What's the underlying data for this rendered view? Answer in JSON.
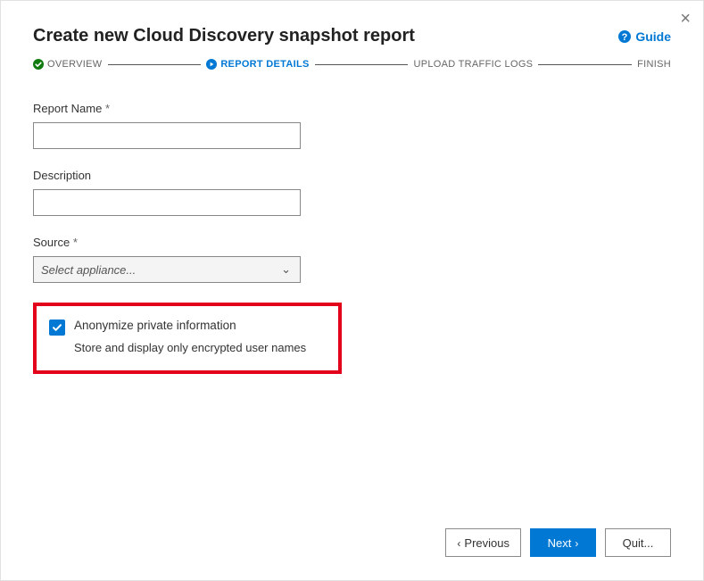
{
  "header": {
    "title": "Create new Cloud Discovery snapshot report",
    "guide_label": "Guide"
  },
  "stepper": {
    "steps": [
      {
        "label": "OVERVIEW",
        "state": "done"
      },
      {
        "label": "REPORT DETAILS",
        "state": "active"
      },
      {
        "label": "UPLOAD TRAFFIC LOGS",
        "state": "pending"
      },
      {
        "label": "FINISH",
        "state": "pending"
      }
    ]
  },
  "form": {
    "report_name": {
      "label": "Report Name",
      "required_mark": "*",
      "value": ""
    },
    "description": {
      "label": "Description",
      "value": ""
    },
    "source": {
      "label": "Source",
      "required_mark": "*",
      "placeholder": "Select appliance..."
    },
    "anonymize": {
      "checked": true,
      "label": "Anonymize private information",
      "sublabel": "Store and display only encrypted user names"
    }
  },
  "footer": {
    "previous": "Previous",
    "next": "Next",
    "quit": "Quit..."
  },
  "icons": {
    "close": "×",
    "chevron_left": "‹",
    "chevron_right": "›",
    "chevron_down": "⌄"
  }
}
